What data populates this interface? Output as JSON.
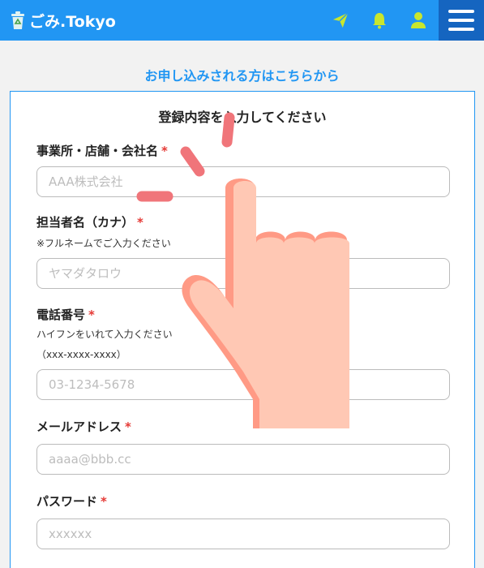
{
  "header": {
    "app_title": "ごみ.Tokyo",
    "icons": [
      "recycle-bin-icon",
      "send-icon",
      "bell-icon",
      "user-icon",
      "hamburger-menu-icon"
    ],
    "brand_color": "#2196f3",
    "icon_color": "#c8e62e"
  },
  "section_heading": "お申し込みされる方はこちらから",
  "form": {
    "title": "登録内容を入力してください",
    "required_mark": "*",
    "fields": [
      {
        "label": "事業所・店舗・会社名",
        "placeholder": "AAA株式会社"
      },
      {
        "label": "担当者名（カナ）",
        "note": "※フルネームでご入力ください",
        "placeholder": "ヤマダタロウ"
      },
      {
        "label": "電話番号",
        "note": "ハイフンをいれて入力ください",
        "note2": "（xxx-xxxx-xxxx）",
        "placeholder": "03-1234-5678"
      },
      {
        "label": "メールアドレス",
        "placeholder": "aaaa@bbb.cc"
      },
      {
        "label": "パスワード",
        "placeholder": "xxxxxx"
      }
    ]
  },
  "overlay": {
    "icon": "tap-hand-icon"
  }
}
